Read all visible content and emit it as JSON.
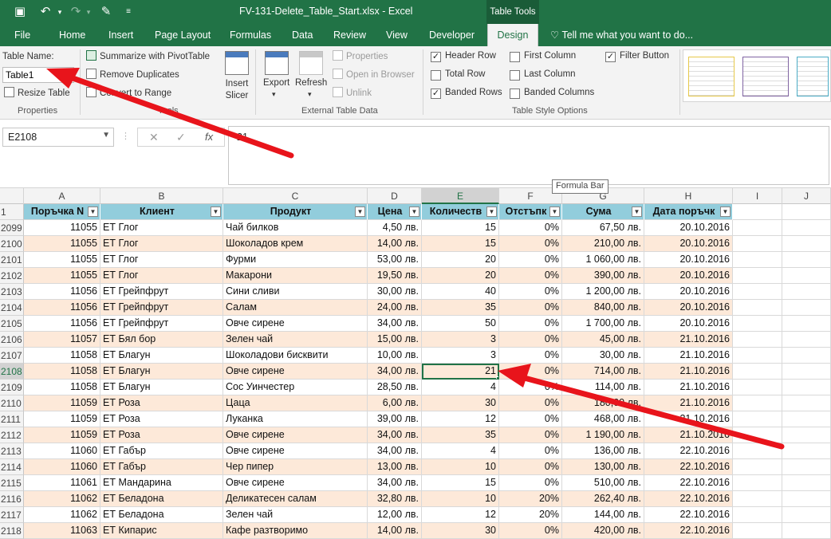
{
  "window": {
    "title": "FV-131-Delete_Table_Start.xlsx - Excel",
    "context_tab_group": "Table Tools"
  },
  "tabs": [
    "File",
    "Home",
    "Insert",
    "Page Layout",
    "Formulas",
    "Data",
    "Review",
    "View",
    "Developer",
    "Design"
  ],
  "active_tab": "Design",
  "tell_me": "Tell me what you want to do...",
  "ribbon": {
    "properties": {
      "table_name_label": "Table Name:",
      "table_name_value": "Table1",
      "resize_table": "Resize Table",
      "group_label": "Properties"
    },
    "tools": {
      "summarize": "Summarize with PivotTable",
      "remove_duplicates": "Remove Duplicates",
      "convert_to_range": "Convert to Range",
      "insert_slicer": "Insert Slicer",
      "group_label": "Tools"
    },
    "external": {
      "export": "Export",
      "refresh": "Refresh",
      "properties": "Properties",
      "open_in_browser": "Open in Browser",
      "unlink": "Unlink",
      "group_label": "External Table Data"
    },
    "style_options": {
      "header_row": {
        "label": "Header Row",
        "checked": true
      },
      "total_row": {
        "label": "Total Row",
        "checked": false
      },
      "banded_rows": {
        "label": "Banded Rows",
        "checked": true
      },
      "first_column": {
        "label": "First Column",
        "checked": false
      },
      "last_column": {
        "label": "Last Column",
        "checked": false
      },
      "banded_columns": {
        "label": "Banded Columns",
        "checked": false
      },
      "filter_button": {
        "label": "Filter Button",
        "checked": true
      },
      "group_label": "Table Style Options"
    }
  },
  "formula_bar": {
    "name_box": "E2108",
    "formula": "21",
    "tooltip": "Formula Bar",
    "fx": "fx"
  },
  "columns": [
    "A",
    "B",
    "C",
    "D",
    "E",
    "F",
    "G",
    "H",
    "I",
    "J"
  ],
  "table": {
    "header_row_number": "1",
    "headers": [
      "Поръчка N",
      "Клиент",
      "Продукт",
      "Цена",
      "Количеств",
      "Отстъпк",
      "Сума",
      "Дата поръчк"
    ],
    "rows": [
      {
        "n": "2099",
        "cells": [
          "11055",
          "ЕТ Глог",
          "Чай билков",
          "4,50 лв.",
          "15",
          "0%",
          "67,50 лв.",
          "20.10.2016"
        ]
      },
      {
        "n": "2100",
        "cells": [
          "11055",
          "ЕТ Глог",
          "Шоколадов крем",
          "14,00 лв.",
          "15",
          "0%",
          "210,00 лв.",
          "20.10.2016"
        ]
      },
      {
        "n": "2101",
        "cells": [
          "11055",
          "ЕТ Глог",
          "Фурми",
          "53,00 лв.",
          "20",
          "0%",
          "1 060,00 лв.",
          "20.10.2016"
        ]
      },
      {
        "n": "2102",
        "cells": [
          "11055",
          "ЕТ Глог",
          "Макарони",
          "19,50 лв.",
          "20",
          "0%",
          "390,00 лв.",
          "20.10.2016"
        ]
      },
      {
        "n": "2103",
        "cells": [
          "11056",
          "ЕТ Грейпфрут",
          "Сини сливи",
          "30,00 лв.",
          "40",
          "0%",
          "1 200,00 лв.",
          "20.10.2016"
        ]
      },
      {
        "n": "2104",
        "cells": [
          "11056",
          "ЕТ Грейпфрут",
          "Салам",
          "24,00 лв.",
          "35",
          "0%",
          "840,00 лв.",
          "20.10.2016"
        ]
      },
      {
        "n": "2105",
        "cells": [
          "11056",
          "ЕТ Грейпфрут",
          "Овче сирене",
          "34,00 лв.",
          "50",
          "0%",
          "1 700,00 лв.",
          "20.10.2016"
        ]
      },
      {
        "n": "2106",
        "cells": [
          "11057",
          "ЕТ Бял бор",
          "Зелен чай",
          "15,00 лв.",
          "3",
          "0%",
          "45,00 лв.",
          "21.10.2016"
        ]
      },
      {
        "n": "2107",
        "cells": [
          "11058",
          "ЕТ Благун",
          "Шоколадови бисквити",
          "10,00 лв.",
          "3",
          "0%",
          "30,00 лв.",
          "21.10.2016"
        ]
      },
      {
        "n": "2108",
        "cells": [
          "11058",
          "ЕТ Благун",
          "Овче сирене",
          "34,00 лв.",
          "21",
          "0%",
          "714,00 лв.",
          "21.10.2016"
        ]
      },
      {
        "n": "2109",
        "cells": [
          "11058",
          "ЕТ Благун",
          "Сос Уинчестер",
          "28,50 лв.",
          "4",
          "0%",
          "114,00 лв.",
          "21.10.2016"
        ]
      },
      {
        "n": "2110",
        "cells": [
          "11059",
          "ЕТ Роза",
          "Цаца",
          "6,00 лв.",
          "30",
          "0%",
          "180,00 лв.",
          "21.10.2016"
        ]
      },
      {
        "n": "2111",
        "cells": [
          "11059",
          "ЕТ Роза",
          "Луканка",
          "39,00 лв.",
          "12",
          "0%",
          "468,00 лв.",
          "21.10.2016"
        ]
      },
      {
        "n": "2112",
        "cells": [
          "11059",
          "ЕТ Роза",
          "Овче сирене",
          "34,00 лв.",
          "35",
          "0%",
          "1 190,00 лв.",
          "21.10.2016"
        ]
      },
      {
        "n": "2113",
        "cells": [
          "11060",
          "ЕТ Габър",
          "Овче сирене",
          "34,00 лв.",
          "4",
          "0%",
          "136,00 лв.",
          "22.10.2016"
        ]
      },
      {
        "n": "2114",
        "cells": [
          "11060",
          "ЕТ Габър",
          "Чер пипер",
          "13,00 лв.",
          "10",
          "0%",
          "130,00 лв.",
          "22.10.2016"
        ]
      },
      {
        "n": "2115",
        "cells": [
          "11061",
          "ЕТ Мандарина",
          "Овче сирене",
          "34,00 лв.",
          "15",
          "0%",
          "510,00 лв.",
          "22.10.2016"
        ]
      },
      {
        "n": "2116",
        "cells": [
          "11062",
          "ЕТ Беладона",
          "Деликатесен салам",
          "32,80 лв.",
          "10",
          "20%",
          "262,40 лв.",
          "22.10.2016"
        ]
      },
      {
        "n": "2117",
        "cells": [
          "11062",
          "ЕТ Беладона",
          "Зелен чай",
          "12,00 лв.",
          "12",
          "20%",
          "144,00 лв.",
          "22.10.2016"
        ]
      },
      {
        "n": "2118",
        "cells": [
          "11063",
          "ЕТ Кипарис",
          "Кафе разтворимо",
          "14,00 лв.",
          "30",
          "0%",
          "420,00 лв.",
          "22.10.2016"
        ]
      }
    ]
  },
  "selected_cell": {
    "column": "E",
    "row": "2108"
  },
  "colors": {
    "excel_green": "#217346",
    "header_fill": "#92cddc",
    "band_fill": "#fde9d9",
    "arrow": "#e8141b"
  }
}
